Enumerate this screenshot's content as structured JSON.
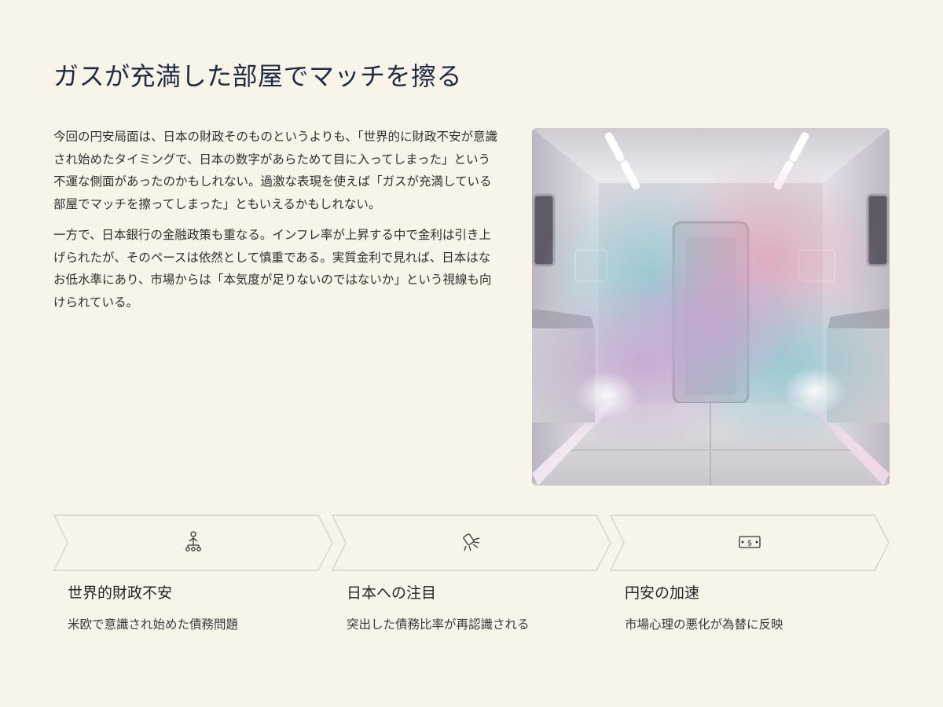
{
  "title": "ガスが充満した部屋でマッチを擦る",
  "paragraphs": [
    "今回の円安局面は、日本の財政そのものというよりも、「世界的に財政不安が意識され始めたタイミングで、日本の数字があらためて目に入ってしまった」という不運な側面があったのかもしれない。過激な表現を使えば「ガスが充満している部屋でマッチを擦ってしまった」ともいえるかもしれない。",
    "一方で、日本銀行の金融政策も重なる。インフレ率が上昇する中で金利は引き上げられたが、そのペースは依然として慎重である。実質金利で見れば、日本はなお低水準にあり、市場からは「本気度が足りないのではないか」という視線も向けられている。"
  ],
  "steps": [
    {
      "icon": "hierarchy-person-icon",
      "title": "世界的財政不安",
      "desc": "米欧で意識され始めた債務問題"
    },
    {
      "icon": "spotlight-icon",
      "title": "日本への注目",
      "desc": "突出した債務比率が再認識される"
    },
    {
      "icon": "banknote-icon",
      "title": "円安の加速",
      "desc": "市場心理の悪化が為替に反映"
    }
  ],
  "colors": {
    "background": "#f8f4ea",
    "title": "#1f2a44",
    "arrow_stroke": "#d3cec4"
  }
}
